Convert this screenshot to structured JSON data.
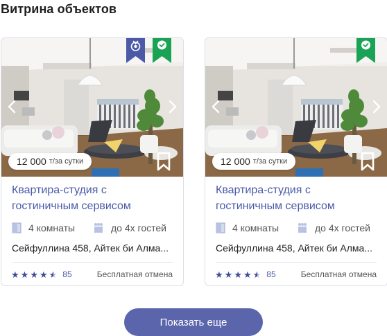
{
  "section": {
    "title": "Витрина объектов"
  },
  "listings": [
    {
      "price": "12 000",
      "price_unit": "т/за сутки",
      "title": "Квартира-студия с гостиничным сервисом",
      "rooms": "4 комнаты",
      "guests": "до 4х гостей",
      "address": "Сейфуллина 458, Айтек би Алма...",
      "rating": 4.5,
      "reviews": "85",
      "cancellation": "Бесплатная отмена",
      "badges": [
        "medal-ribbon-icon",
        "verified-ribbon-icon"
      ]
    },
    {
      "price": "12 000",
      "price_unit": "т/за сутки",
      "title": "Квартира-студия с гостиничным сервисом",
      "rooms": "4 комнаты",
      "guests": "до 4х гостей",
      "address": "Сейфуллина 458, Айтек би Алма...",
      "rating": 4.5,
      "reviews": "85",
      "cancellation": "Бесплатная отмена",
      "badges": [
        "verified-ribbon-icon"
      ]
    }
  ],
  "actions": {
    "show_more": "Показать еще"
  },
  "colors": {
    "accent": "#5a65ac",
    "link": "#4a5aa8",
    "medal_ribbon": "#4b59a6",
    "verified_ribbon": "#1aa354"
  }
}
